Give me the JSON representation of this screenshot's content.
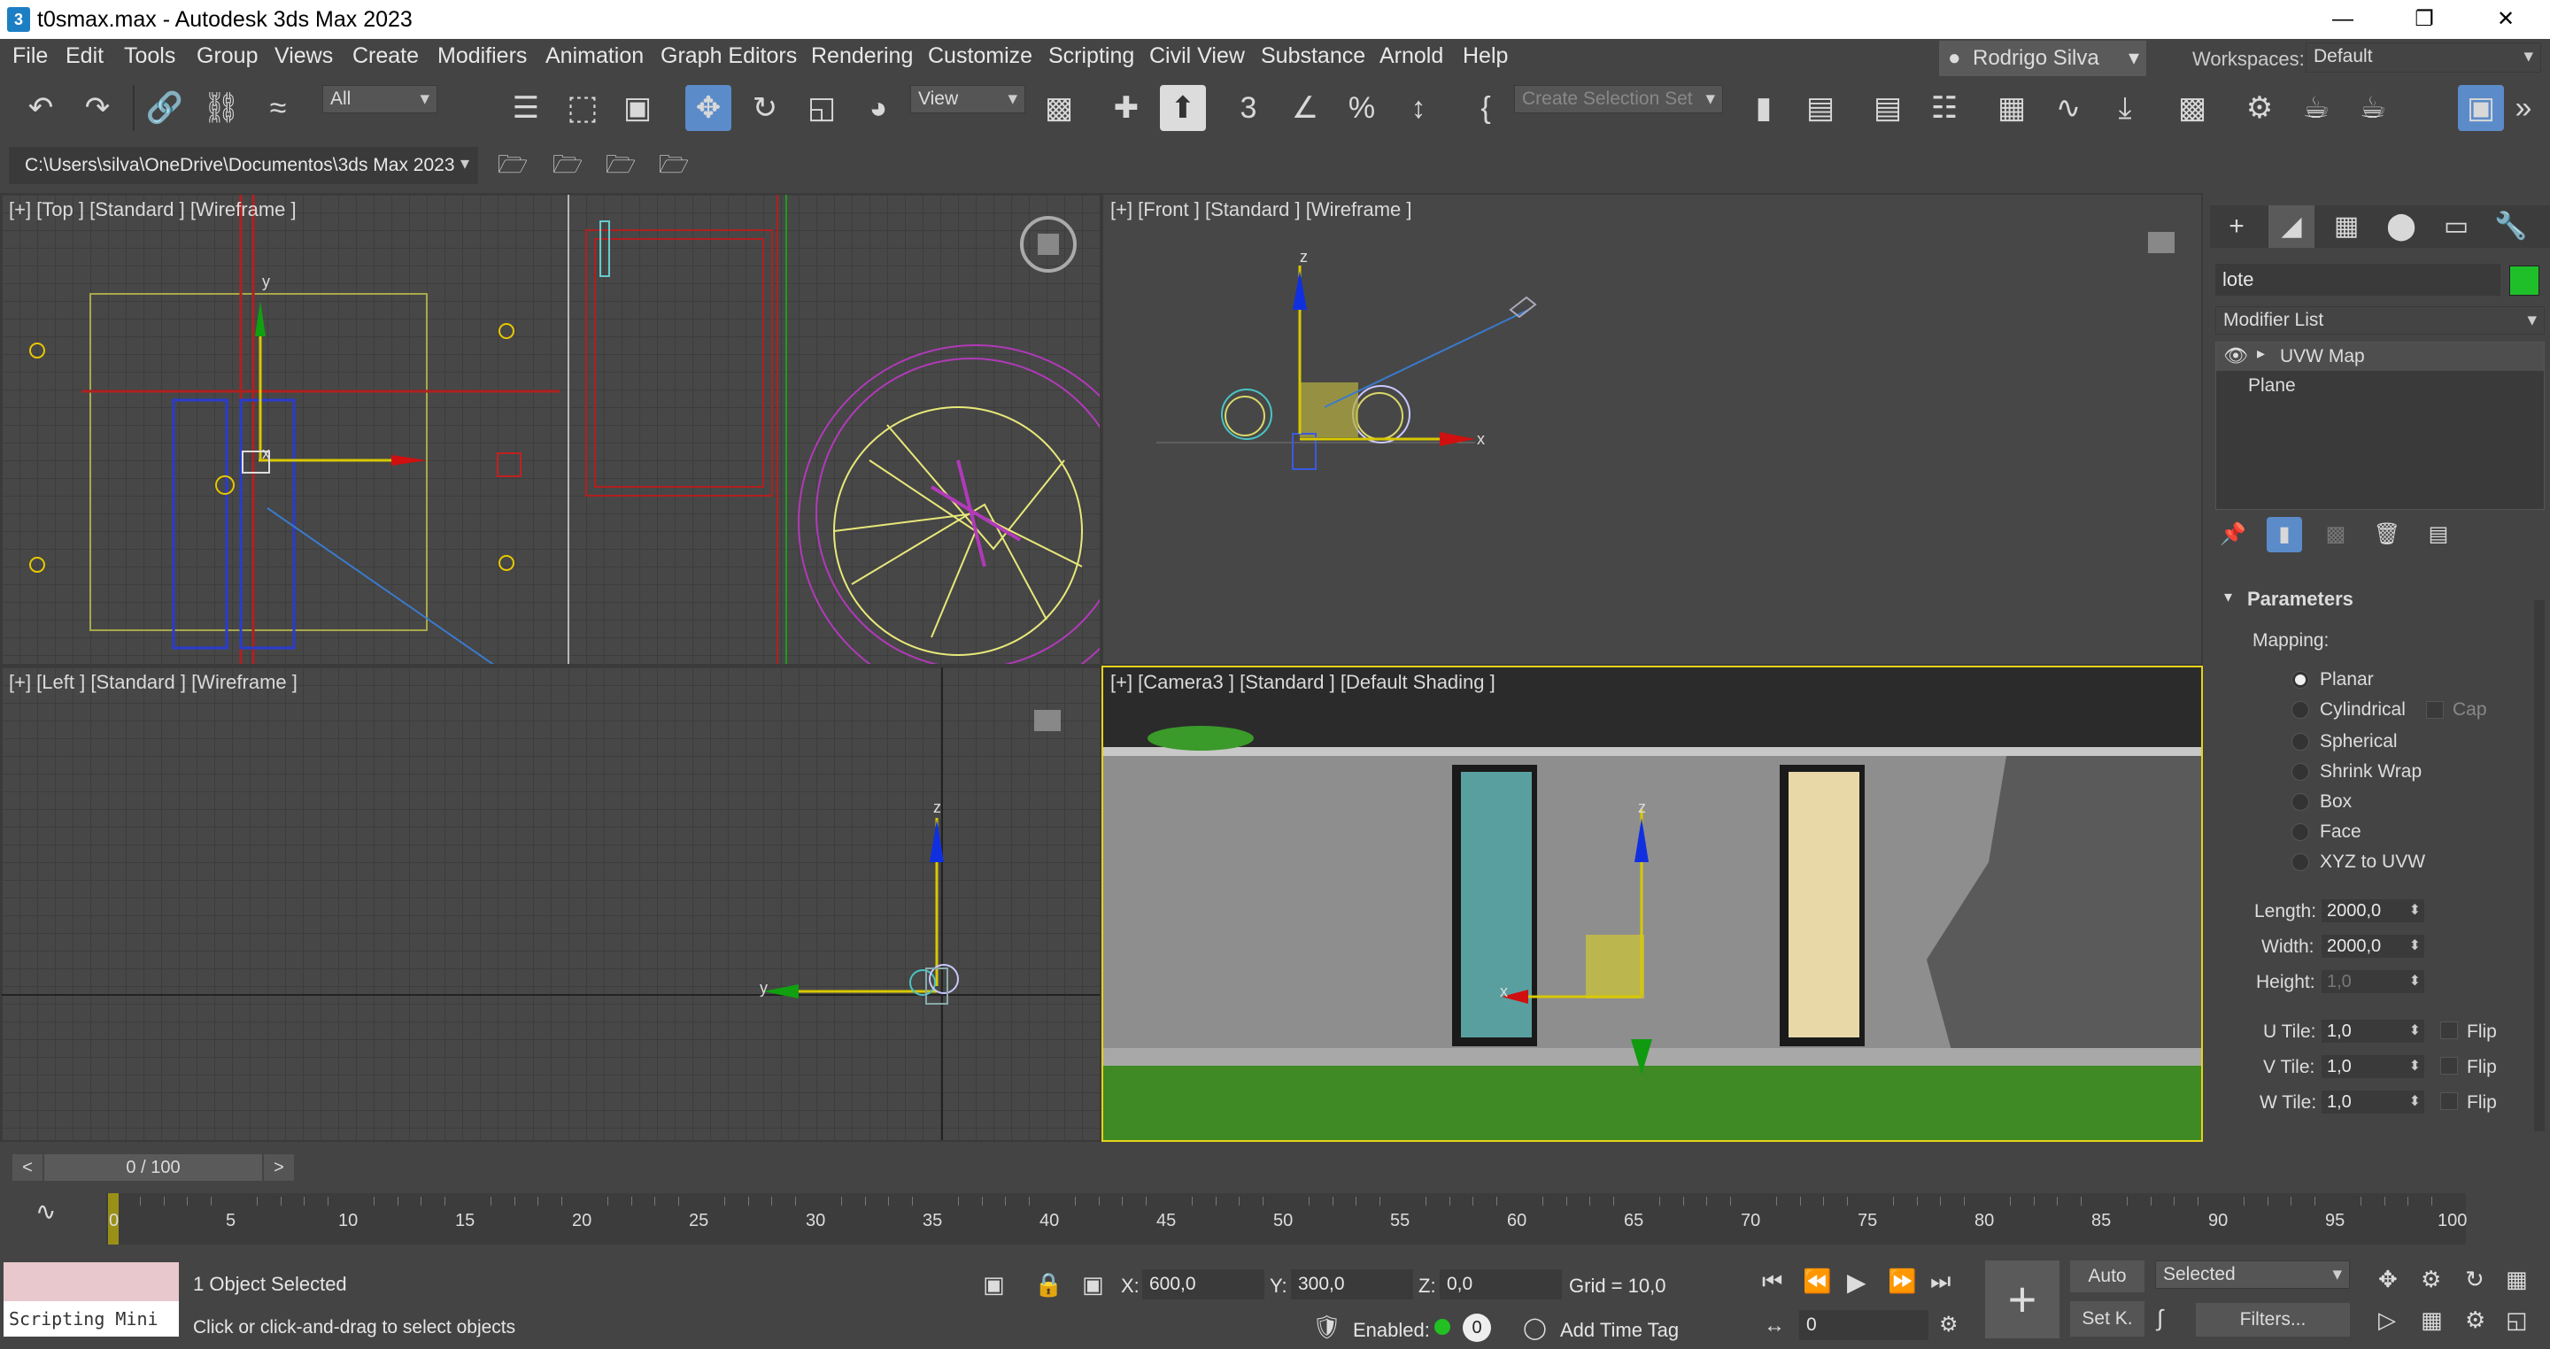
{
  "window": {
    "title": "t0smax.max - Autodesk 3ds Max 2023",
    "app_icon": "3"
  },
  "menu": [
    "File",
    "Edit",
    "Tools",
    "Group",
    "Views",
    "Create",
    "Modifiers",
    "Animation",
    "Graph Editors",
    "Rendering",
    "Customize",
    "Scripting",
    "Civil View",
    "Substance",
    "Arnold",
    "Help"
  ],
  "user": {
    "name": "Rodrigo Silva",
    "workspaces_label": "Workspaces:",
    "workspace": "Default"
  },
  "toolbar": {
    "filter": "All",
    "refcoord": "View",
    "selection_set_placeholder": "Create Selection Set"
  },
  "project_path": "C:\\Users\\silva\\OneDrive\\Documentos\\3ds Max 2023",
  "viewports": {
    "top": {
      "label": "[+] [Top ] [Standard ] [Wireframe ]"
    },
    "front": {
      "label": "[+] [Front ] [Standard ] [Wireframe ]"
    },
    "left": {
      "label": "[+] [Left ] [Standard ] [Wireframe ]"
    },
    "camera": {
      "label": "[+] [Camera3 ] [Standard ] [Default Shading ]"
    }
  },
  "command_panel": {
    "object_name": "lote",
    "object_color": "#1fbf2a",
    "modifier_list": "Modifier List",
    "stack": [
      "UVW Map",
      "Plane"
    ],
    "rollout": "Parameters",
    "mapping_label": "Mapping:",
    "mapping_options": [
      "Planar",
      "Cylindrical",
      "Spherical",
      "Shrink Wrap",
      "Box",
      "Face",
      "XYZ to UVW"
    ],
    "mapping_selected": "Planar",
    "cap_label": "Cap",
    "length_label": "Length:",
    "length": "2000,0",
    "width_label": "Width:",
    "width": "2000,0",
    "height_label": "Height:",
    "height": "1,0",
    "utile_label": "U Tile:",
    "utile": "1,0",
    "vtile_label": "V Tile:",
    "vtile": "1,0",
    "wtile_label": "W Tile:",
    "wtile": "1,0",
    "flip_label": "Flip"
  },
  "timeline": {
    "frame_display": "0 / 100",
    "ticks": [
      "0",
      "5",
      "10",
      "15",
      "20",
      "25",
      "30",
      "35",
      "40",
      "45",
      "50",
      "55",
      "60",
      "65",
      "70",
      "75",
      "80",
      "85",
      "90",
      "95",
      "100"
    ]
  },
  "status": {
    "maxscript": "Scripting Mini",
    "selected": "1 Object Selected",
    "prompt": "Click or click-and-drag to select objects",
    "x_label": "X:",
    "x": "600,0",
    "y_label": "Y:",
    "y": "300,0",
    "z_label": "Z:",
    "z": "0,0",
    "grid": "Grid = 10,0",
    "enabled_label": "Enabled:",
    "enabled_value": "0",
    "add_time_tag": "Add Time Tag",
    "auto": "Auto",
    "set_key": "Set K.",
    "key_filter": "Selected",
    "filters": "Filters...",
    "current_frame": "0"
  },
  "colors": {
    "accent": "#5b8bc9",
    "gizmo_x": "#d01010",
    "gizmo_y": "#10a010",
    "gizmo_z": "#1030e0"
  }
}
